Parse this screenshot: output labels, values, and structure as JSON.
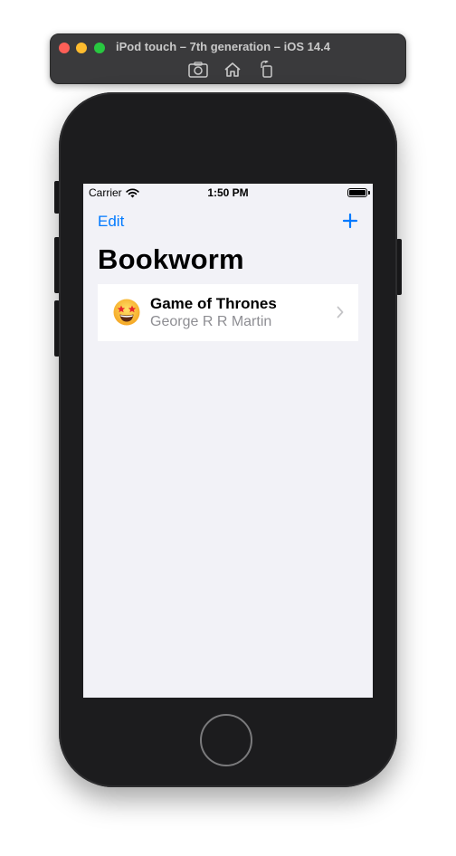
{
  "simulator": {
    "title": "iPod touch – 7th generation – iOS 14.4",
    "tools": [
      {
        "name": "screenshot-icon"
      },
      {
        "name": "home-icon"
      },
      {
        "name": "rotate-icon"
      }
    ]
  },
  "status_bar": {
    "carrier": "Carrier",
    "time": "1:50 PM"
  },
  "nav_bar": {
    "edit_label": "Edit",
    "add_icon": "plus-icon",
    "title": "Bookworm"
  },
  "books": [
    {
      "emoji_icon": "star-struck-emoji",
      "title": "Game of Thrones",
      "author": "George R R Martin"
    }
  ],
  "colors": {
    "accent": "#007aff",
    "background": "#f2f2f7",
    "secondary_text": "#8e8e93",
    "device_body": "#1c1c1e"
  }
}
